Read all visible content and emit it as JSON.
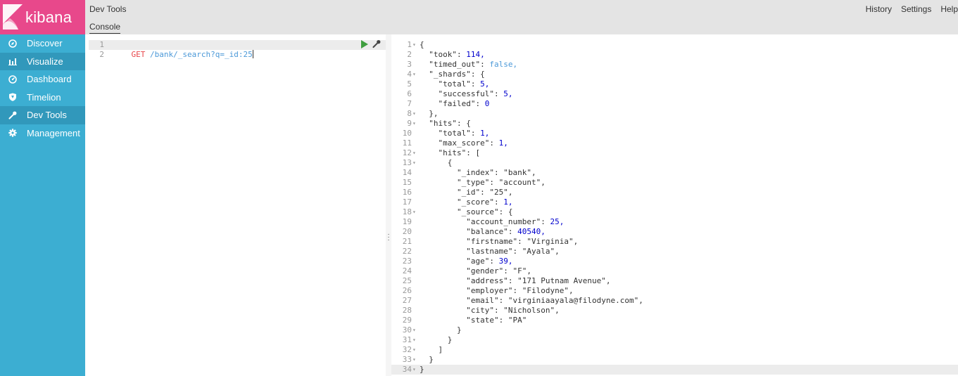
{
  "app": {
    "logo_text": "kibana",
    "brand_color": "#e8488b",
    "sidebar_color": "#3caed2"
  },
  "sidebar": {
    "items": [
      {
        "label": "Discover",
        "icon": "compass-icon"
      },
      {
        "label": "Visualize",
        "icon": "bar-chart-icon"
      },
      {
        "label": "Dashboard",
        "icon": "dashboard-icon"
      },
      {
        "label": "Timelion",
        "icon": "shield-icon"
      },
      {
        "label": "Dev Tools",
        "icon": "wrench-icon"
      },
      {
        "label": "Management",
        "icon": "gear-icon"
      }
    ]
  },
  "header": {
    "title": "Dev Tools",
    "tab": "Console",
    "links": [
      "History",
      "Settings",
      "Help"
    ]
  },
  "editor": {
    "lines": [
      "1",
      "2"
    ],
    "method": "GET",
    "url": " /bank/_search?q=_id:25"
  },
  "output": {
    "lines": [
      {
        "n": "1",
        "fold": true,
        "text": "{"
      },
      {
        "n": "2",
        "text": "  \"took\": 114,"
      },
      {
        "n": "3",
        "text": "  \"timed_out\": false,"
      },
      {
        "n": "4",
        "fold": true,
        "text": "  \"_shards\": {"
      },
      {
        "n": "5",
        "text": "    \"total\": 5,"
      },
      {
        "n": "6",
        "text": "    \"successful\": 5,"
      },
      {
        "n": "7",
        "text": "    \"failed\": 0"
      },
      {
        "n": "8",
        "fold": true,
        "text": "  },"
      },
      {
        "n": "9",
        "fold": true,
        "text": "  \"hits\": {"
      },
      {
        "n": "10",
        "text": "    \"total\": 1,"
      },
      {
        "n": "11",
        "text": "    \"max_score\": 1,"
      },
      {
        "n": "12",
        "fold": true,
        "text": "    \"hits\": ["
      },
      {
        "n": "13",
        "fold": true,
        "text": "      {"
      },
      {
        "n": "14",
        "text": "        \"_index\": \"bank\","
      },
      {
        "n": "15",
        "text": "        \"_type\": \"account\","
      },
      {
        "n": "16",
        "text": "        \"_id\": \"25\","
      },
      {
        "n": "17",
        "text": "        \"_score\": 1,"
      },
      {
        "n": "18",
        "fold": true,
        "text": "        \"_source\": {"
      },
      {
        "n": "19",
        "text": "          \"account_number\": 25,"
      },
      {
        "n": "20",
        "text": "          \"balance\": 40540,"
      },
      {
        "n": "21",
        "text": "          \"firstname\": \"Virginia\","
      },
      {
        "n": "22",
        "text": "          \"lastname\": \"Ayala\","
      },
      {
        "n": "23",
        "text": "          \"age\": 39,"
      },
      {
        "n": "24",
        "text": "          \"gender\": \"F\","
      },
      {
        "n": "25",
        "text": "          \"address\": \"171 Putnam Avenue\","
      },
      {
        "n": "26",
        "text": "          \"employer\": \"Filodyne\","
      },
      {
        "n": "27",
        "text": "          \"email\": \"virginiaayala@filodyne.com\","
      },
      {
        "n": "28",
        "text": "          \"city\": \"Nicholson\","
      },
      {
        "n": "29",
        "text": "          \"state\": \"PA\""
      },
      {
        "n": "30",
        "fold": true,
        "text": "        }"
      },
      {
        "n": "31",
        "fold": true,
        "text": "      }"
      },
      {
        "n": "32",
        "fold": true,
        "text": "    ]"
      },
      {
        "n": "33",
        "fold": true,
        "text": "  }"
      },
      {
        "n": "34",
        "fold": true,
        "text": "}"
      }
    ]
  }
}
